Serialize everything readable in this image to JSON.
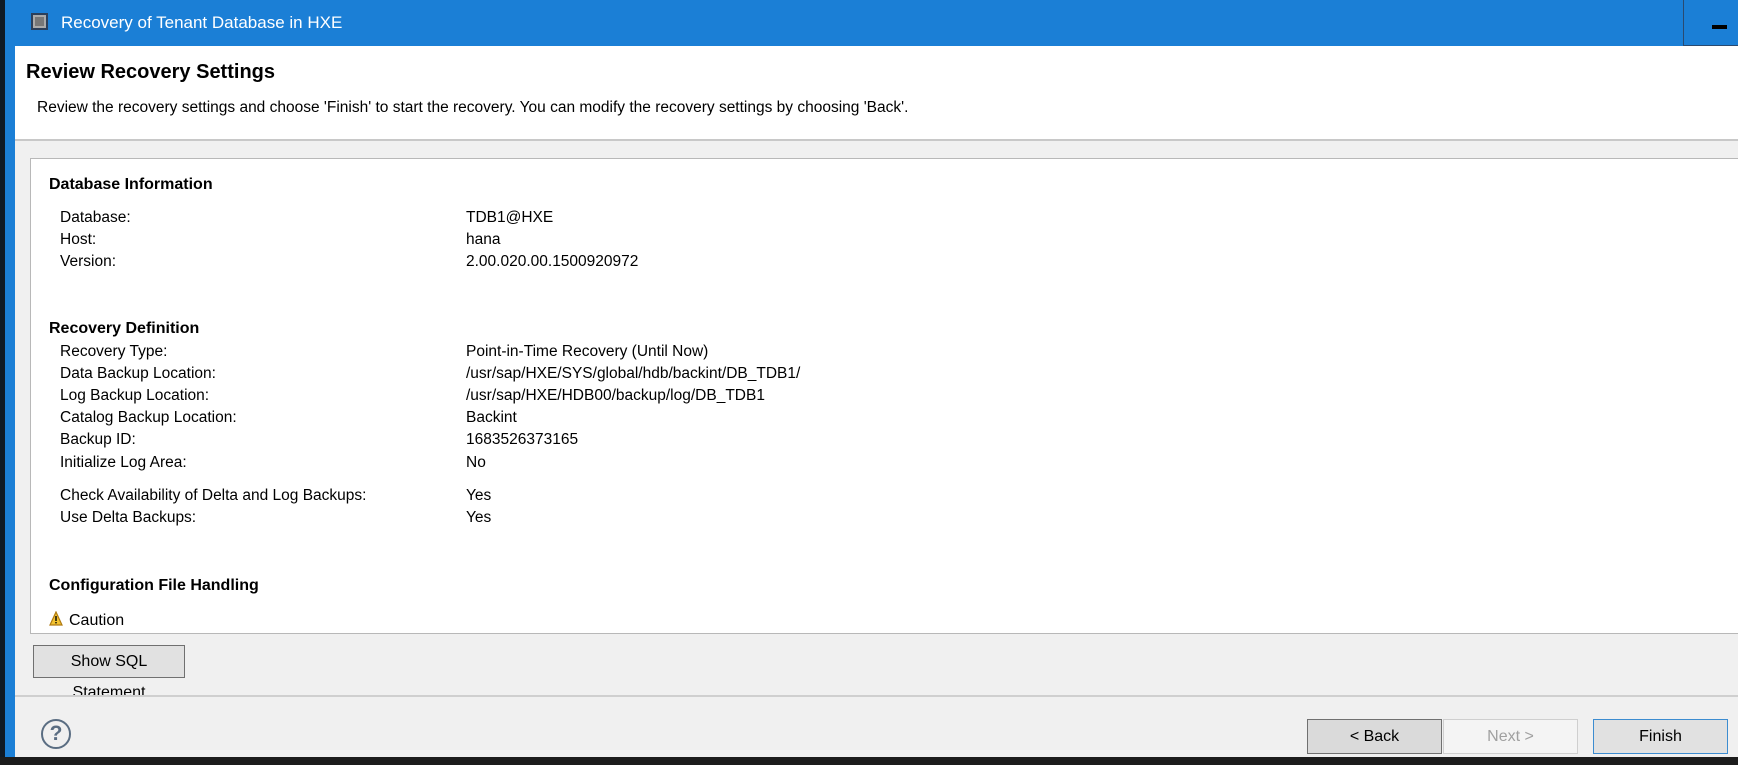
{
  "window": {
    "title": "Recovery of Tenant Database in HXE"
  },
  "header": {
    "title": "Review Recovery Settings",
    "description": "Review the recovery settings and choose 'Finish' to start the recovery. You can modify the recovery settings by choosing 'Back'."
  },
  "database_info": {
    "heading": "Database Information",
    "rows": [
      {
        "label": "Database:",
        "value": "TDB1@HXE"
      },
      {
        "label": "Host:",
        "value": "hana"
      },
      {
        "label": "Version:",
        "value": "2.00.020.00.1500920972"
      }
    ]
  },
  "recovery_definition": {
    "heading": "Recovery Definition",
    "rows": [
      {
        "label": "Recovery Type:",
        "value": "Point-in-Time Recovery (Until Now)"
      },
      {
        "label": "Data Backup Location:",
        "value": "/usr/sap/HXE/SYS/global/hdb/backint/DB_TDB1/"
      },
      {
        "label": "Log Backup Location:",
        "value": "/usr/sap/HXE/HDB00/backup/log/DB_TDB1"
      },
      {
        "label": "Catalog Backup Location:",
        "value": "Backint"
      },
      {
        "label": "Backup ID:",
        "value": "1683526373165"
      },
      {
        "label": "Initialize Log Area:",
        "value": "No"
      },
      {
        "label": "Check Availability of Delta and Log Backups:",
        "value": "Yes"
      },
      {
        "label": "Use Delta Backups:",
        "value": "Yes"
      }
    ]
  },
  "config_file": {
    "heading": "Configuration File Handling",
    "caution": "Caution"
  },
  "buttons": {
    "show_sql": "Show SQL Statement",
    "back": "< Back",
    "next": "Next >",
    "finish": "Finish",
    "help": "?"
  }
}
